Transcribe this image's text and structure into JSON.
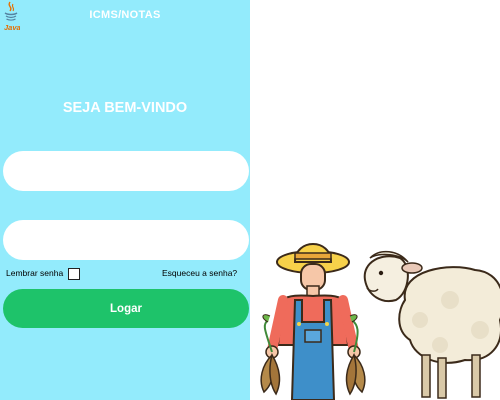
{
  "header": {
    "title": "ICMS/NOTAS",
    "logo_text": "Java"
  },
  "main": {
    "welcome": "SEJA BEM-VINDO",
    "username_field": {
      "value": "",
      "placeholder": ""
    },
    "password_field": {
      "value": "",
      "placeholder": ""
    },
    "remember_label": "Lembrar senha",
    "remember_checked": false,
    "forgot_link": "Esqueceu a senha?",
    "login_button": "Logar"
  },
  "colors": {
    "panel_bg": "#93ebfc",
    "button_bg": "#1ec36a",
    "text_light": "#ffffff"
  },
  "icons": [
    "java-logo-icon",
    "farmer-illustration",
    "sheep-illustration"
  ]
}
